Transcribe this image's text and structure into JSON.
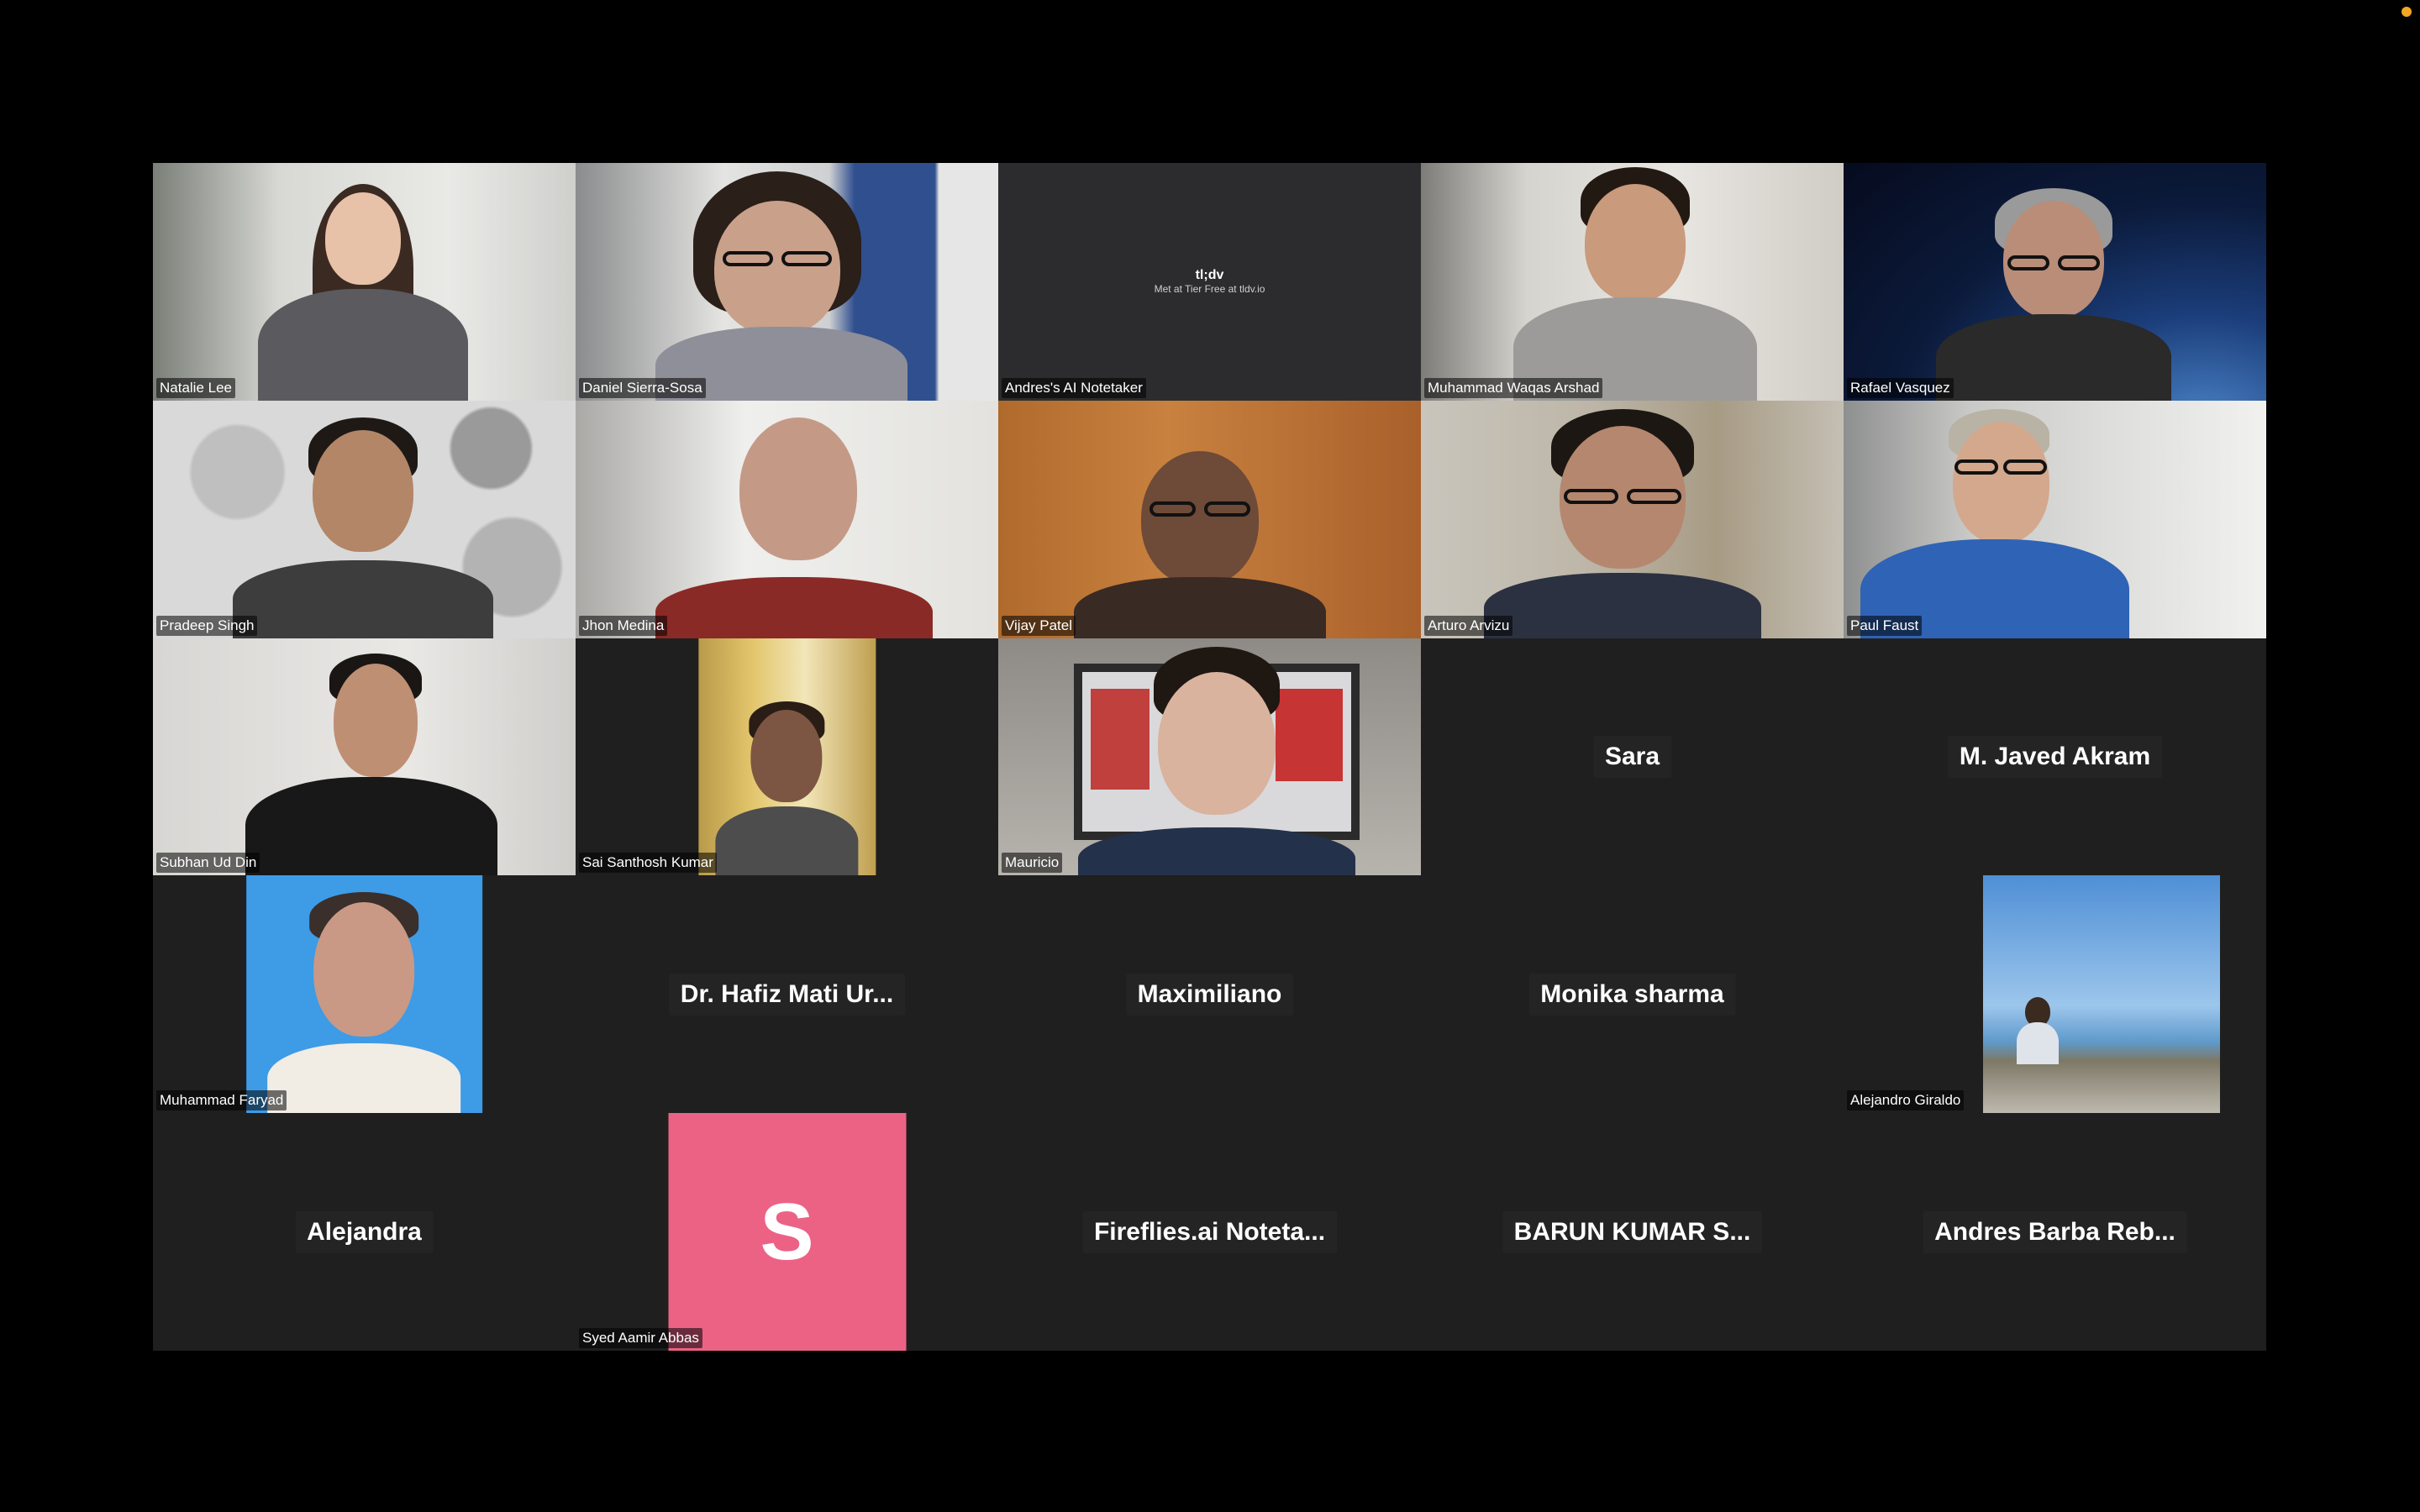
{
  "window": {
    "recording_indicator_color": "#f5a623"
  },
  "participants": [
    {
      "name": "Natalie Lee",
      "mode": "video"
    },
    {
      "name": "Daniel Sierra-Sosa",
      "mode": "video"
    },
    {
      "name": "Andres's AI Notetaker",
      "mode": "video",
      "logo_text": "tl;dv",
      "logo_sub": "Met at Tier Free at tldv.io"
    },
    {
      "name": "Muhammad Waqas Arshad",
      "mode": "video"
    },
    {
      "name": "Rafael Vasquez",
      "mode": "video"
    },
    {
      "name": "Pradeep Singh",
      "mode": "video"
    },
    {
      "name": "Jhon Medina",
      "mode": "video"
    },
    {
      "name": "Vijay Patel",
      "mode": "video"
    },
    {
      "name": "Arturo Arvizu",
      "mode": "video"
    },
    {
      "name": "Paul Faust",
      "mode": "video"
    },
    {
      "name": "Subhan Ud Din",
      "mode": "video"
    },
    {
      "name": "Sai Santhosh Kumar",
      "mode": "video"
    },
    {
      "name": "Mauricio",
      "mode": "video"
    },
    {
      "name": "Sara",
      "mode": "name-only"
    },
    {
      "name": "M. Javed Akram",
      "mode": "name-only"
    },
    {
      "name": "Muhammad Faryad",
      "mode": "photo"
    },
    {
      "name": "Dr. Hafiz Mati Ur...",
      "mode": "name-only"
    },
    {
      "name": "Maximiliano",
      "mode": "name-only"
    },
    {
      "name": "Monika sharma",
      "mode": "name-only"
    },
    {
      "name": "Alejandro Giraldo",
      "mode": "photo"
    },
    {
      "name": "Alejandra",
      "mode": "name-only"
    },
    {
      "name": "Syed Aamir Abbas",
      "mode": "avatar",
      "avatar_letter": "S",
      "avatar_color": "#ec6285"
    },
    {
      "name": "Fireflies.ai  Noteta...",
      "mode": "name-only"
    },
    {
      "name": "BARUN  KUMAR  S...",
      "mode": "name-only"
    },
    {
      "name": "Andres  Barba  Reb...",
      "mode": "name-only"
    }
  ]
}
